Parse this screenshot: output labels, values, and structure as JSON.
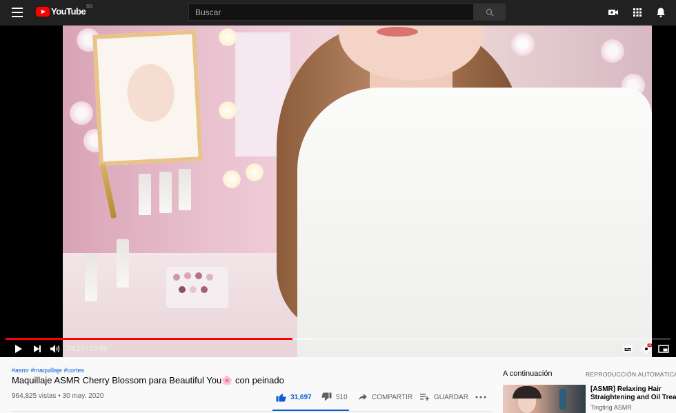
{
  "header": {
    "logo_text": "YouTube",
    "logo_region": "DO",
    "search_placeholder": "Buscar",
    "icons": [
      "menu-icon",
      "search-icon",
      "create-video-icon",
      "apps-grid-icon",
      "bell-icon"
    ]
  },
  "player": {
    "current_time": "24:10",
    "duration": "55:59",
    "time_display": "24:10 / 55:59",
    "played_fraction": 0.4317,
    "buffered_fraction": 0.462,
    "controls": [
      "play-icon",
      "next-icon",
      "volume-icon",
      "subtitles-icon",
      "settings-icon",
      "miniplayer-icon"
    ],
    "settings_badge": "HD",
    "progress_color": "#ff0000"
  },
  "video_info": {
    "hashtags": "#asmr #maquillaje #cortes",
    "title": "Maquillaje ASMR Cherry Blossom para Beautiful You🌸 con peinado",
    "views": "964,825 vistas",
    "separator": "•",
    "date": "30 may. 2020",
    "likes": "31,697",
    "dislikes": "510",
    "share_label": "COMPARTIR",
    "save_label": "GUARDAR",
    "accent_color": "#065fd4"
  },
  "sidebar": {
    "up_next_label": "A continuación",
    "autoplay_label": "REPRODUCCIÓN AUTOMÁTICA",
    "recommendation": {
      "title_line1": "[ASMR] Relaxing Hair",
      "title_line2": "Straightening and Oil Treatment",
      "channel": "Tingting ASMR"
    }
  }
}
